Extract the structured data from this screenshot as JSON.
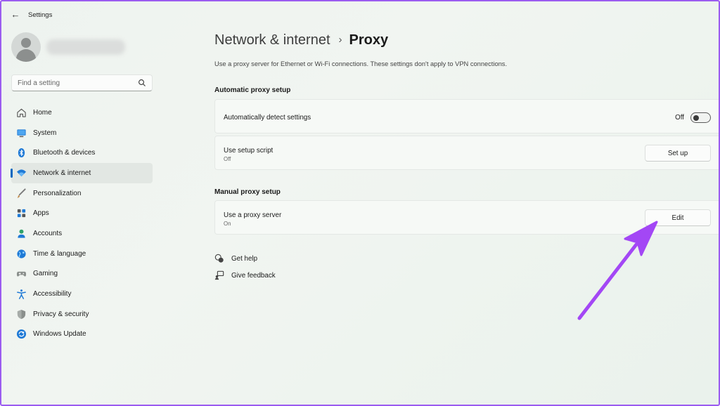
{
  "window": {
    "title": "Settings",
    "back_label": "←"
  },
  "sidebar": {
    "search": {
      "placeholder": "Find a setting"
    },
    "items": [
      {
        "label": "Home",
        "icon": "home-icon",
        "active": false
      },
      {
        "label": "System",
        "icon": "system-icon",
        "active": false
      },
      {
        "label": "Bluetooth & devices",
        "icon": "bluetooth-icon",
        "active": false
      },
      {
        "label": "Network & internet",
        "icon": "wifi-icon",
        "active": true
      },
      {
        "label": "Personalization",
        "icon": "brush-icon",
        "active": false
      },
      {
        "label": "Apps",
        "icon": "apps-icon",
        "active": false
      },
      {
        "label": "Accounts",
        "icon": "accounts-icon",
        "active": false
      },
      {
        "label": "Time & language",
        "icon": "globe-icon",
        "active": false
      },
      {
        "label": "Gaming",
        "icon": "gamepad-icon",
        "active": false
      },
      {
        "label": "Accessibility",
        "icon": "accessibility-icon",
        "active": false
      },
      {
        "label": "Privacy & security",
        "icon": "shield-icon",
        "active": false
      },
      {
        "label": "Windows Update",
        "icon": "update-icon",
        "active": false
      }
    ]
  },
  "main": {
    "breadcrumb": {
      "parent": "Network & internet",
      "separator": "›",
      "current": "Proxy"
    },
    "description": "Use a proxy server for Ethernet or Wi-Fi connections. These settings don't apply to VPN connections.",
    "automatic": {
      "title": "Automatic proxy setup",
      "detect": {
        "label": "Automatically detect settings",
        "state": "Off"
      },
      "script": {
        "label": "Use setup script",
        "sub": "Off",
        "button": "Set up"
      }
    },
    "manual": {
      "title": "Manual proxy setup",
      "proxy": {
        "label": "Use a proxy server",
        "sub": "On",
        "button": "Edit"
      }
    },
    "links": {
      "help": "Get help",
      "feedback": "Give feedback"
    }
  },
  "colors": {
    "accent": "#0067c0",
    "annotation_arrow": "#a347f5",
    "frame_border": "#9b5cf0"
  }
}
